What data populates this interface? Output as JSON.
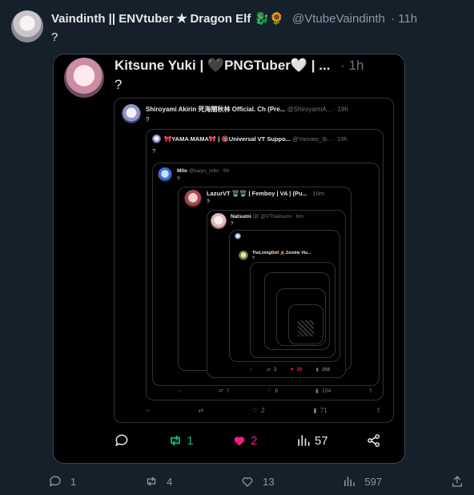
{
  "tweet": {
    "display_name": "Vaindinth || ENVtuber ✭ Dragon Elf 🐉🌻",
    "handle": "@VtubeVaindinth",
    "time": "· 11h",
    "text": "?",
    "stats": {
      "replies": "1",
      "retweets": "4",
      "likes": "13",
      "views": "597"
    }
  },
  "quote1": {
    "display_name": "Kitsune Yuki | 🖤PNGTuber🤍 | ...",
    "time": "· 1h",
    "text": "?",
    "stats": {
      "retweets": "1",
      "likes": "2",
      "views": "57"
    }
  },
  "quote2": {
    "display_name": "Shiroyami Akirin 死海闇秋林 Official. Ch (Pre...",
    "handle": "@ShiroyamiA...",
    "time": "· 19h",
    "text": "?"
  },
  "quote3": {
    "display_name": "🎀YAMA MAMA🎀 | 🔞Universal VT Suppo...",
    "handle": "@Yamato_Ib...",
    "time": "· 19h",
    "text": "?",
    "stats": {
      "retweets": "7",
      "likes": "8",
      "views": "104"
    }
  },
  "quote4": {
    "display_name": "Milo",
    "handle": "@kaiyo_milo",
    "time": "· 9h",
    "text": "?",
    "stats": {
      "likes": "2",
      "views": "71"
    }
  },
  "quote5": {
    "display_name": "LazurVT 🗑️🗑️ | Femboy | VA | (Pu...",
    "time": "· 10m",
    "text": "?"
  },
  "quote6": {
    "display_name": "Natsumi 🕸️",
    "handle": "@VTNatsumi",
    "time": "· 6m",
    "text": "?",
    "stats": {
      "retweets": "2",
      "likes": "10",
      "views": "268"
    }
  },
  "quote7": {
    "display_name": "TheLivingDoll 🧸 Zombie Vtu...",
    "text": "?"
  },
  "icons": [
    "reply-icon",
    "retweet-icon",
    "heart-icon",
    "views-icon",
    "share-icon"
  ],
  "colors": {
    "bg": "#15202b",
    "retweet_green": "#00ba7c",
    "like_pink": "#f91880",
    "muted": "#8b98a5"
  }
}
